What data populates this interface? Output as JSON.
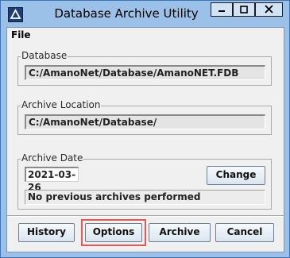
{
  "window": {
    "title": "Database Archive Utility"
  },
  "menu": {
    "file_label": "File"
  },
  "database_group": {
    "label": "Database",
    "path": "C:/AmanoNet/Database/AmanoNET.FDB"
  },
  "archive_location_group": {
    "label": "Archive Location",
    "path": "C:/AmanoNet/Database/"
  },
  "archive_date_group": {
    "label": "Archive Date",
    "date_value": "2021-03-26",
    "change_label": "Change",
    "status_text": "No previous archives performed"
  },
  "buttons": {
    "history_label": "History",
    "options_label": "Options",
    "archive_label": "Archive",
    "cancel_label": "Cancel"
  },
  "colors": {
    "title_bar": "#9cc1e9",
    "highlight": "#e35a52"
  }
}
